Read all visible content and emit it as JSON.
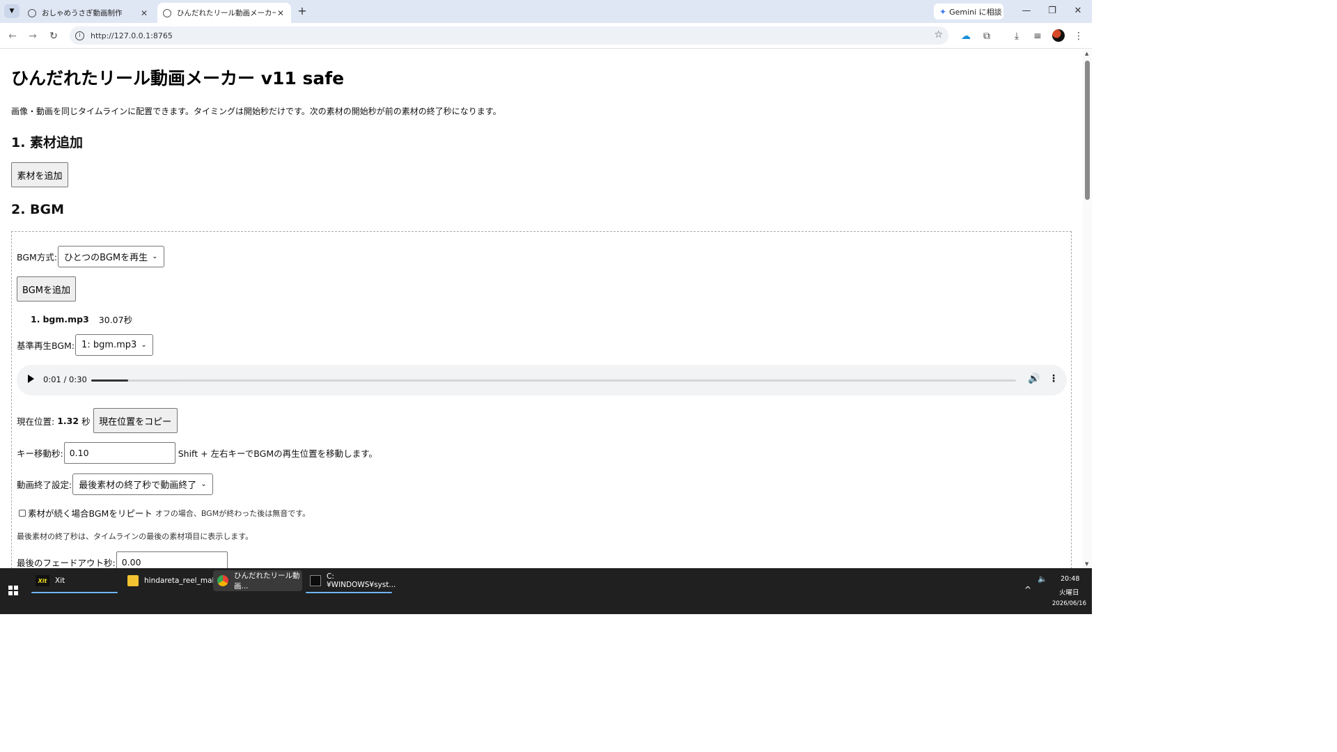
{
  "browser": {
    "tabs": [
      {
        "title": "おしゃめうさぎ動画制作",
        "active": false
      },
      {
        "title": "ひんだれたリール動画メーカー v11 safe",
        "active": true
      }
    ],
    "new_tab": "+",
    "gemini_label": "Gemini に相談",
    "url": "http://127.0.0.1:8765",
    "window_controls": {
      "minimize": "—",
      "restore": "❐",
      "close": "✕"
    }
  },
  "page": {
    "title": "ひんだれたリール動画メーカー v11 safe",
    "description": "画像・動画を同じタイムラインに配置できます。タイミングは開始秒だけです。次の素材の開始秒が前の素材の終了秒になります。",
    "section1": {
      "heading": "1. 素材追加",
      "add_button": "素材を追加"
    },
    "section2": {
      "heading": "2. BGM",
      "mode_label": "BGM方式:",
      "mode_value": "ひとつのBGMを再生",
      "add_bgm_button": "BGMを追加",
      "bgm_list": [
        {
          "index": "1.",
          "name": "bgm.mp3",
          "duration": "30.07秒"
        }
      ],
      "base_bgm_label": "基準再生BGM:",
      "base_bgm_value": "1: bgm.mp3",
      "player": {
        "time": "0:01 / 0:30",
        "progress_fraction": 0.04
      },
      "position_label": "現在位置:",
      "position_value": "1.32",
      "position_unit": "秒",
      "copy_button": "現在位置をコピー",
      "key_move_label": "キー移動秒:",
      "key_move_value": "0.10",
      "key_move_hint": "Shift + 左右キーでBGMの再生位置を移動します。",
      "end_setting_label": "動画終了設定:",
      "end_setting_value": "最後素材の終了秒で動画終了",
      "repeat_checkbox_label": "素材が続く場合BGMをリピート",
      "repeat_checked": false,
      "repeat_note": "オフの場合、BGMが終わった後は無音です。",
      "last_end_note": "最後素材の終了秒は、タイムラインの最後の素材項目に表示します。",
      "fadeout_label": "最後のフェードアウト秒:",
      "fadeout_value": "0.00"
    }
  },
  "taskbar": {
    "apps": [
      {
        "name": "Xit",
        "icon_text": "Xit"
      },
      {
        "name": "hindareta_reel_mak..."
      },
      {
        "name": "ひんだれたリール動画..."
      },
      {
        "name": "C:¥WINDOWS¥syst..."
      }
    ],
    "clock_time": "20:48",
    "clock_day": "火曜日",
    "clock_date": "2026/06/16"
  }
}
